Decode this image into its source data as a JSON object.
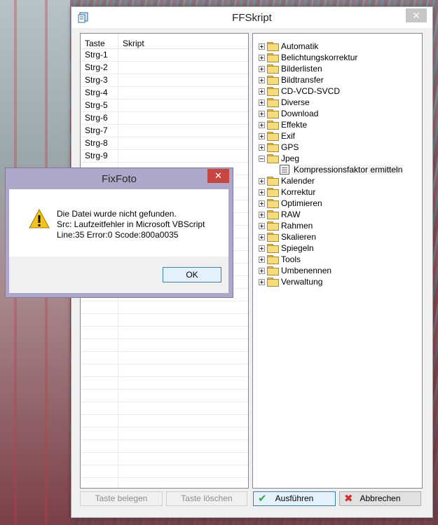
{
  "window": {
    "title": "FFSkript",
    "close_glyph": "✕"
  },
  "table": {
    "headers": [
      "Taste",
      "Skript"
    ],
    "rows": [
      {
        "key": "Strg-1",
        "script": ""
      },
      {
        "key": "Strg-2",
        "script": ""
      },
      {
        "key": "Strg-3",
        "script": ""
      },
      {
        "key": "Strg-4",
        "script": ""
      },
      {
        "key": "Strg-5",
        "script": ""
      },
      {
        "key": "Strg-6",
        "script": ""
      },
      {
        "key": "Strg-7",
        "script": ""
      },
      {
        "key": "Strg-8",
        "script": ""
      },
      {
        "key": "Strg-9",
        "script": ""
      }
    ]
  },
  "tree": {
    "items": [
      {
        "label": "Automatik",
        "level": 0,
        "expanded": false
      },
      {
        "label": "Belichtungskorrektur",
        "level": 0,
        "expanded": false
      },
      {
        "label": "Bilderlisten",
        "level": 0,
        "expanded": false
      },
      {
        "label": "Bildtransfer",
        "level": 0,
        "expanded": false
      },
      {
        "label": "CD-VCD-SVCD",
        "level": 0,
        "expanded": false
      },
      {
        "label": "Diverse",
        "level": 0,
        "expanded": false
      },
      {
        "label": "Download",
        "level": 0,
        "expanded": false
      },
      {
        "label": "Effekte",
        "level": 0,
        "expanded": false
      },
      {
        "label": "Exif",
        "level": 0,
        "expanded": false
      },
      {
        "label": "GPS",
        "level": 0,
        "expanded": false
      },
      {
        "label": "Jpeg",
        "level": 0,
        "expanded": true
      },
      {
        "label": "Kompressionsfaktor ermitteln",
        "level": 1,
        "selected": true
      },
      {
        "label": "Kalender",
        "level": 0,
        "expanded": false
      },
      {
        "label": "Korrektur",
        "level": 0,
        "expanded": false
      },
      {
        "label": "Optimieren",
        "level": 0,
        "expanded": false
      },
      {
        "label": "RAW",
        "level": 0,
        "expanded": false
      },
      {
        "label": "Rahmen",
        "level": 0,
        "expanded": false
      },
      {
        "label": "Skalieren",
        "level": 0,
        "expanded": false
      },
      {
        "label": "Spiegeln",
        "level": 0,
        "expanded": false
      },
      {
        "label": "Tools",
        "level": 0,
        "expanded": false
      },
      {
        "label": "Umbenennen",
        "level": 0,
        "expanded": false
      },
      {
        "label": "Verwaltung",
        "level": 0,
        "expanded": false
      }
    ]
  },
  "buttons": {
    "assign_key": "Taste belegen",
    "delete_key": "Taste löschen",
    "run": "Ausführen",
    "cancel": "Abbrechen",
    "run_icon": "checkmark-icon",
    "cancel_icon": "cross-icon"
  },
  "dialog": {
    "title": "FixFoto",
    "close_glyph": "✕",
    "icon": "warning-icon",
    "lines": [
      "Die Datei wurde nicht gefunden.",
      "Src: Laufzeitfehler in Microsoft VBScript",
      "Line:35 Error:0 Scode:800a0035"
    ],
    "ok_label": "OK"
  }
}
